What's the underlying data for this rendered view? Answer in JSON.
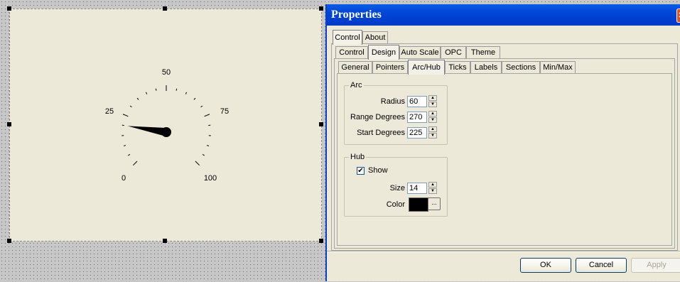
{
  "window": {
    "title": "Properties",
    "close_glyph": "✕"
  },
  "tabs": {
    "top": [
      {
        "label": "Control",
        "active": true
      },
      {
        "label": "About",
        "active": false
      }
    ],
    "second": [
      {
        "label": "Control",
        "active": false
      },
      {
        "label": "Design",
        "active": true
      },
      {
        "label": "Auto Scale",
        "active": false
      },
      {
        "label": "OPC",
        "active": false
      },
      {
        "label": "Theme",
        "active": false
      }
    ],
    "third": [
      {
        "label": "General",
        "active": false
      },
      {
        "label": "Pointers",
        "active": false
      },
      {
        "label": "Arc/Hub",
        "active": true
      },
      {
        "label": "Ticks",
        "active": false
      },
      {
        "label": "Labels",
        "active": false
      },
      {
        "label": "Sections",
        "active": false
      },
      {
        "label": "Min/Max",
        "active": false
      }
    ]
  },
  "arc": {
    "legend": "Arc",
    "radius_label": "Radius",
    "radius": "60",
    "range_label": "Range Degrees",
    "range": "270",
    "start_label": "Start Degrees",
    "start": "225"
  },
  "hub": {
    "legend": "Hub",
    "show_label": "Show",
    "show_checked": true,
    "check_glyph": "✔",
    "size_label": "Size",
    "size": "14",
    "color_label": "Color",
    "color": "#000000",
    "ellipsis": "..."
  },
  "buttons": {
    "ok": "OK",
    "cancel": "Cancel",
    "apply": "Apply"
  },
  "gauge": {
    "labels": [
      "0",
      "25",
      "50",
      "75",
      "100"
    ],
    "min": 0,
    "max": 100,
    "value": 20,
    "start_degrees": 225,
    "range_degrees": 270
  },
  "icons": {
    "spin_up": "up-arrow-icon",
    "spin_down": "down-arrow-icon",
    "close": "close-icon"
  }
}
